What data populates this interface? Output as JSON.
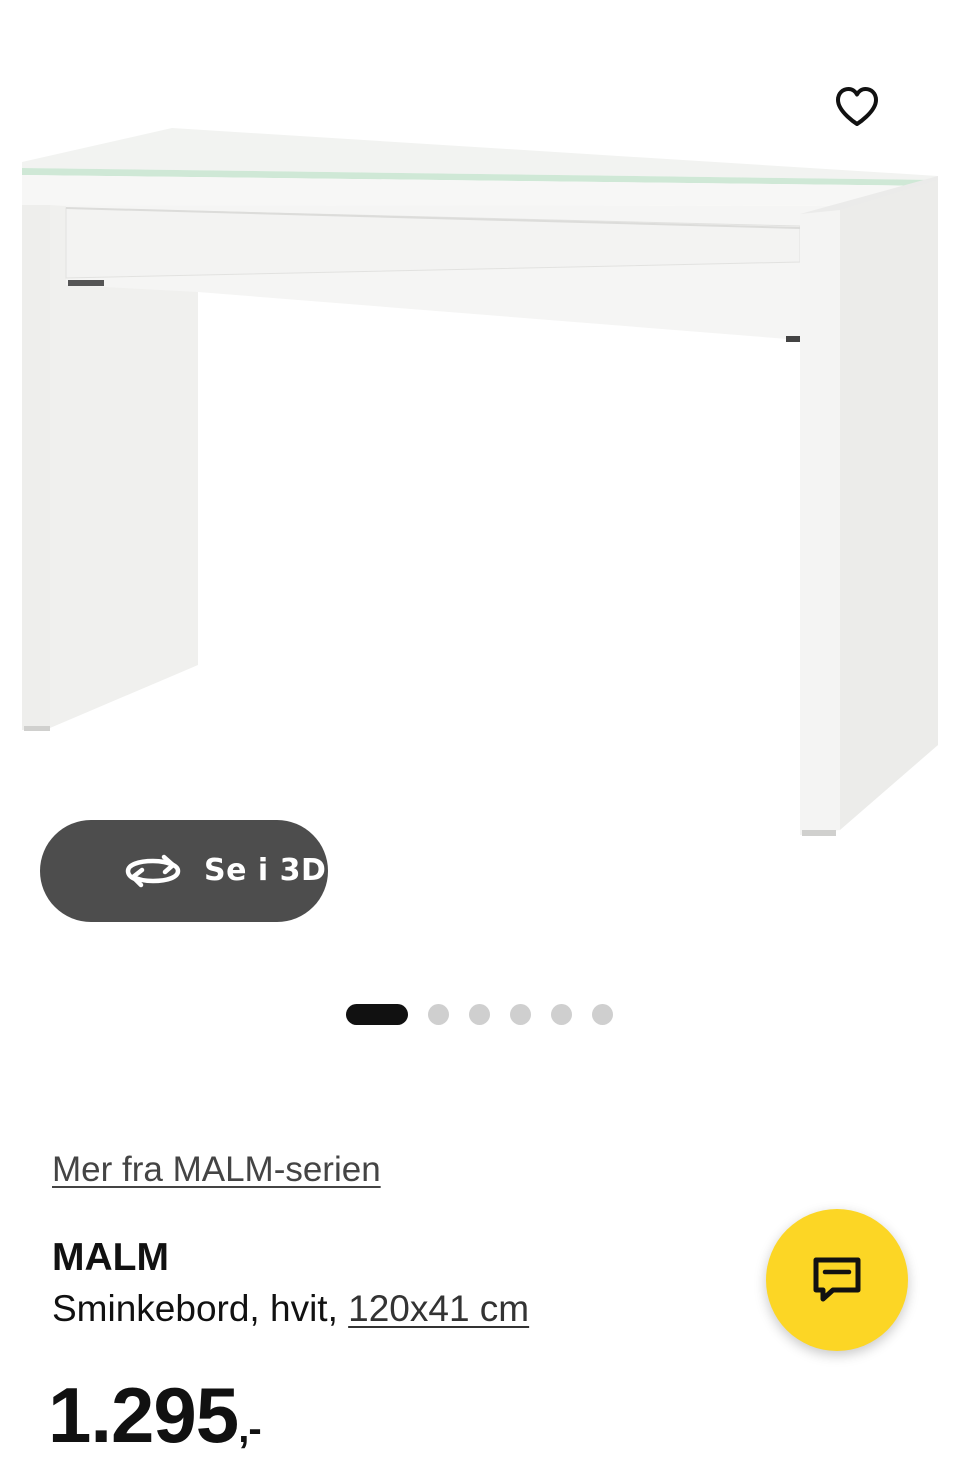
{
  "gallery": {
    "image_alt": "MALM sminkebord hvit",
    "favorite_icon": "heart-outline-icon",
    "view_3d": {
      "label": "Se i 3D",
      "icon": "rotate-3d-icon"
    },
    "slides_total": 6,
    "active_slide": 1
  },
  "product": {
    "series_link": "Mer fra MALM-serien",
    "name": "MALM",
    "description": "Sminkebord, hvit, ",
    "size": "120x41 cm",
    "price": "1.295",
    "price_suffix": ",-"
  },
  "chat": {
    "icon": "chat-bubble-icon"
  },
  "colors": {
    "accent_yellow": "#fcd625",
    "pill_gray": "#4d4d4d",
    "dot_inactive": "#cfcfcf"
  }
}
